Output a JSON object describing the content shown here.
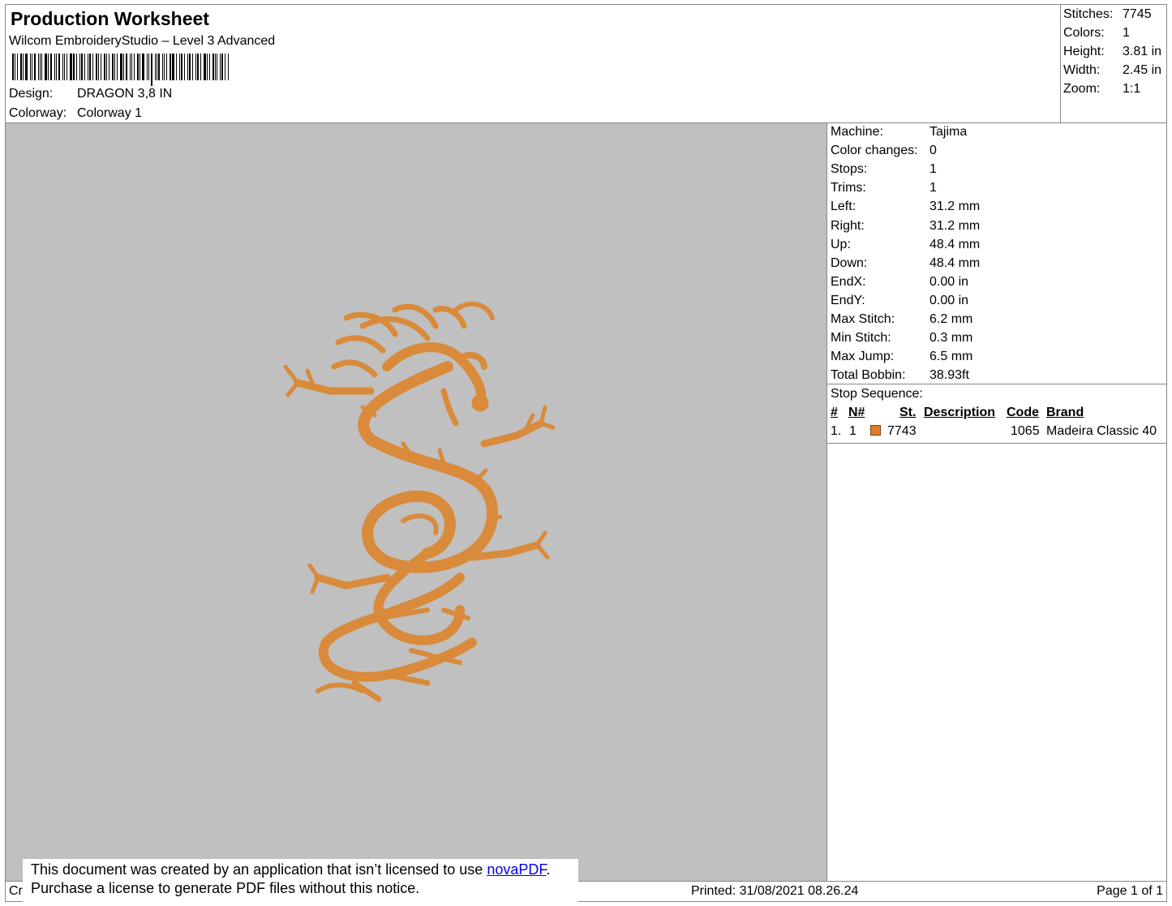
{
  "header": {
    "title": "Production Worksheet",
    "software": "Wilcom EmbroideryStudio – Level 3 Advanced",
    "design_label": "Design:",
    "design_value": "DRAGON 3,8 IN",
    "colorway_label": "Colorway:",
    "colorway_value": "Colorway 1"
  },
  "summary": [
    {
      "label": "Stitches:",
      "value": "7745"
    },
    {
      "label": "Colors:",
      "value": "1"
    },
    {
      "label": "Height:",
      "value": "3.81 in"
    },
    {
      "label": "Width:",
      "value": "2.45 in"
    },
    {
      "label": "Zoom:",
      "value": "1:1"
    }
  ],
  "machine_stats": [
    {
      "label": "Machine:",
      "value": "Tajima"
    },
    {
      "label": "Color changes:",
      "value": "0"
    },
    {
      "label": "Stops:",
      "value": "1"
    },
    {
      "label": "Trims:",
      "value": "1"
    },
    {
      "label": "Left:",
      "value": "31.2 mm"
    },
    {
      "label": "Right:",
      "value": "31.2 mm"
    },
    {
      "label": "Up:",
      "value": "48.4 mm"
    },
    {
      "label": "Down:",
      "value": "48.4 mm"
    },
    {
      "label": "EndX:",
      "value": "0.00 in"
    },
    {
      "label": "EndY:",
      "value": "0.00 in"
    },
    {
      "label": "Max Stitch:",
      "value": "6.2 mm"
    },
    {
      "label": "Min Stitch:",
      "value": "0.3 mm"
    },
    {
      "label": "Max Jump:",
      "value": "6.5 mm"
    },
    {
      "label": "Total Bobbin:",
      "value": "38.93ft"
    }
  ],
  "stop_sequence": {
    "title": "Stop Sequence:",
    "columns": {
      "index": "#",
      "needle": "N#",
      "stitches": "St.",
      "description": "Description",
      "code": "Code",
      "brand": "Brand"
    },
    "rows": [
      {
        "index": "1.",
        "needle": "1",
        "color": "#e07b2a",
        "stitches": "7743",
        "description": "",
        "code": "1065",
        "brand": "Madeira Classic 40"
      }
    ]
  },
  "design_preview": {
    "background": "#c0c0c0",
    "thread_color": "#d98a3a"
  },
  "footer": {
    "left_text": "Cr",
    "printed": "Printed: 31/08/2021 08.26.24",
    "page": "Page 1 of 1"
  },
  "notice": {
    "line1_prefix": "This document was created by an application that isn’t licensed to use ",
    "link_text": "novaPDF",
    "line1_suffix": ".",
    "line2": "Purchase a license to generate PDF files without this notice."
  }
}
